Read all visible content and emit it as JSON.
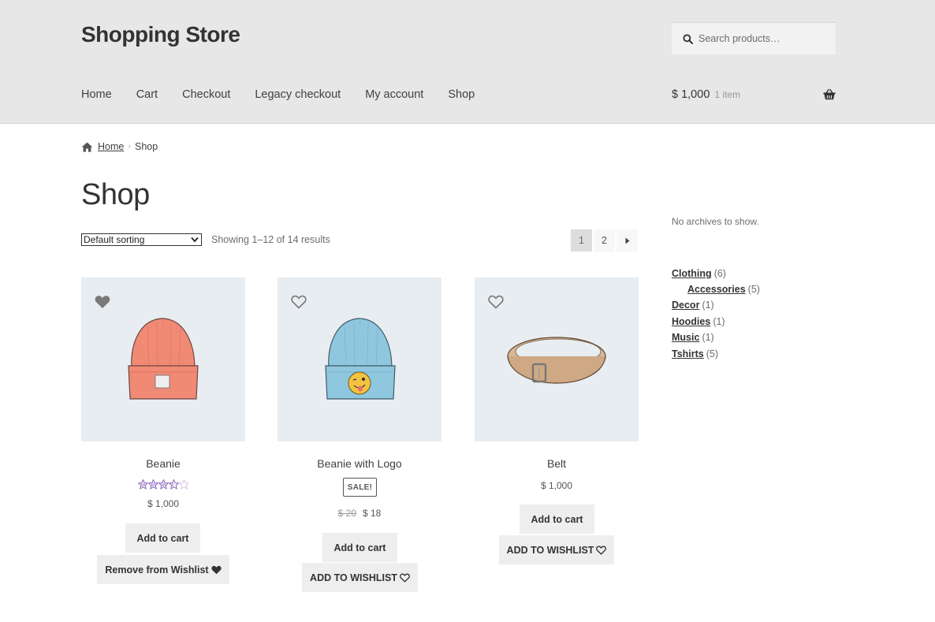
{
  "header": {
    "site_title": "Shopping Store",
    "search_placeholder": "Search products…",
    "nav": [
      "Home",
      "Cart",
      "Checkout",
      "Legacy checkout",
      "My account",
      "Shop"
    ],
    "cart_total": "$ 1,000",
    "cart_count": "1 item"
  },
  "breadcrumb": {
    "home": "Home",
    "current": "Shop"
  },
  "page_title": "Shop",
  "toolbar": {
    "sort_selected": "Default sorting",
    "result_prefix": "Showing ",
    "result_range": "1–12",
    "result_suffix": " of 14 results",
    "pages": [
      "1",
      "2"
    ]
  },
  "products": [
    {
      "name": "Beanie",
      "rating": 3.5,
      "price": "$ 1,000",
      "button": "Add to cart",
      "wishlist": "Remove from Wishlist",
      "wishlisted": true
    },
    {
      "name": "Beanie with Logo",
      "sale_badge": "SALE!",
      "old_price": "$ 20",
      "price": "$ 18",
      "button": "Add to cart",
      "wishlist": "ADD TO WISHLIST",
      "wishlisted": false
    },
    {
      "name": "Belt",
      "price": "$ 1,000",
      "button": "Add to cart",
      "wishlist": "ADD TO WISHLIST",
      "wishlisted": false
    }
  ],
  "sidebar": {
    "archives_text": "No archives to show.",
    "categories": [
      {
        "name": "Clothing",
        "count": "(6)"
      },
      {
        "name": "Accessories",
        "count": "(5)"
      },
      {
        "name": "Decor",
        "count": "(1)"
      },
      {
        "name": "Hoodies",
        "count": "(1)"
      },
      {
        "name": "Music",
        "count": "(1)"
      },
      {
        "name": "Tshirts",
        "count": "(5)"
      }
    ]
  },
  "colors": {
    "header_bg": "#e7e7e7",
    "thumb_bg": "#e8edf1",
    "button_bg": "#eeeeee",
    "star_color": "#7f54b3"
  },
  "icons": [
    "search-icon",
    "basket-icon",
    "home-icon",
    "heart-icon",
    "caret-right-icon",
    "star-icon"
  ]
}
